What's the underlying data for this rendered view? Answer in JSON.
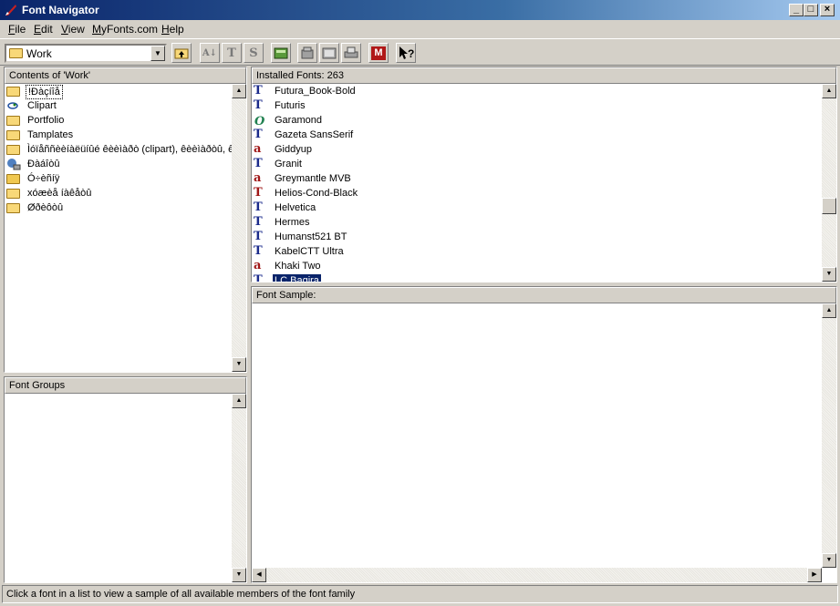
{
  "window": {
    "title": "Font Navigator"
  },
  "menu": [
    {
      "label": "File",
      "u": "F",
      "rest": "ile"
    },
    {
      "label": "Edit",
      "u": "E",
      "rest": "dit"
    },
    {
      "label": "View",
      "u": "V",
      "rest": "iew"
    },
    {
      "label": "MyFonts.com",
      "u": "M",
      "rest": "yFonts.com"
    },
    {
      "label": "Help",
      "u": "H",
      "rest": "elp"
    }
  ],
  "toolbar": {
    "folder_value": "Work",
    "buttons": [
      "up-folder-icon",
      "sort-az-icon",
      "truetype-icon",
      "type1-icon",
      "add-font-icon",
      "install-icon",
      "properties-icon",
      "print-icon",
      "myfonts-icon",
      "context-help-icon"
    ]
  },
  "contents": {
    "header": "Contents of 'Work'",
    "items": [
      {
        "label": "!Ðàçíîå",
        "icon": "folder-icon",
        "selected_outline": true
      },
      {
        "label": "Clipart",
        "icon": "clipart-icon"
      },
      {
        "label": "Portfolio",
        "icon": "folder-icon"
      },
      {
        "label": "Tamplates",
        "icon": "folder-icon"
      },
      {
        "label": "Ìóïåññèèíàëüíûé êèèìàðò (clipart), êèèìàðòû, êè",
        "icon": "folder-icon"
      },
      {
        "label": "Ðàáîòû",
        "icon": "network-icon"
      },
      {
        "label": "Ó÷èñíÿ",
        "icon": "folder-open-icon"
      },
      {
        "label": "xóæèå íàêåòû",
        "icon": "folder-icon"
      },
      {
        "label": "Øðèôòû",
        "icon": "folder-icon"
      }
    ]
  },
  "font_groups": {
    "header": "Font Groups"
  },
  "installed": {
    "header": "Installed Fonts: 263",
    "items": [
      {
        "label": "Futura_Book-Bold",
        "icon": "truetype-icon"
      },
      {
        "label": "Futuris",
        "icon": "truetype-icon"
      },
      {
        "label": "Garamond",
        "icon": "opentype-icon"
      },
      {
        "label": "Gazeta SansSerif",
        "icon": "truetype-icon"
      },
      {
        "label": "Giddyup",
        "icon": "type1-icon"
      },
      {
        "label": "Granit",
        "icon": "truetype-icon"
      },
      {
        "label": "Greymantle MVB",
        "icon": "type1-icon"
      },
      {
        "label": "Helios-Cond-Black",
        "icon": "type1-red-icon"
      },
      {
        "label": "Helvetica",
        "icon": "truetype-icon"
      },
      {
        "label": "Hermes",
        "icon": "truetype-icon"
      },
      {
        "label": "Humanst521 BT",
        "icon": "truetype-icon"
      },
      {
        "label": "KabelCTT Ultra",
        "icon": "truetype-icon"
      },
      {
        "label": "Khaki Two",
        "icon": "type1-icon"
      },
      {
        "label": "LC Bagira",
        "icon": "truetype-icon",
        "selected": true
      }
    ]
  },
  "sample": {
    "header": "Font Sample:"
  },
  "status": "Click a font in a list to view a sample of all available members of the font family"
}
